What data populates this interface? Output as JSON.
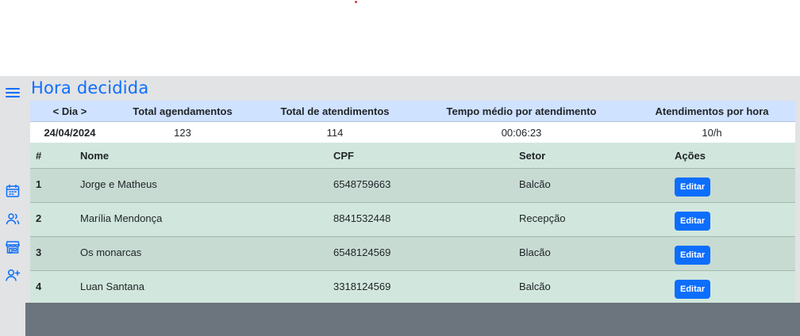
{
  "page": {
    "title": "Hora decidida"
  },
  "colors": {
    "accent": "#0d6efd",
    "stats_header": "#cfe2ff",
    "table_bg": "#d1e7dd",
    "footer": "#6c757d",
    "sidebar_bg": "#e2e3e5"
  },
  "sidebar": {
    "icons": [
      "menu-icon",
      "calendar-icon",
      "users-icon",
      "store-icon",
      "add-user-icon"
    ]
  },
  "stats": {
    "headers": {
      "day": "< Dia >",
      "total_agendamentos": "Total agendamentos",
      "total_atendimentos": "Total de atendimentos",
      "tempo_medio": "Tempo médio por atendimento",
      "atendimentos_hora": "Atendimentos por hora"
    },
    "values": {
      "date": "24/04/2024",
      "total_agendamentos": "123",
      "total_atendimentos": "114",
      "tempo_medio": "00:06:23",
      "atendimentos_hora": "10/h"
    }
  },
  "table": {
    "columns": {
      "num": "#",
      "nome": "Nome",
      "cpf": "CPF",
      "setor": "Setor",
      "acoes": "Ações"
    },
    "rows": [
      {
        "num": "1",
        "nome": "Jorge e Matheus",
        "cpf": "6548759663",
        "setor": "Balcão",
        "action": "Editar"
      },
      {
        "num": "2",
        "nome": "Marília Mendonça",
        "cpf": "8841532448",
        "setor": "Recepção",
        "action": "Editar"
      },
      {
        "num": "3",
        "nome": "Os monarcas",
        "cpf": "6548124569",
        "setor": "Blacão",
        "action": "Editar"
      },
      {
        "num": "4",
        "nome": "Luan Santana",
        "cpf": "3318124569",
        "setor": "Balcão",
        "action": "Editar"
      }
    ]
  }
}
